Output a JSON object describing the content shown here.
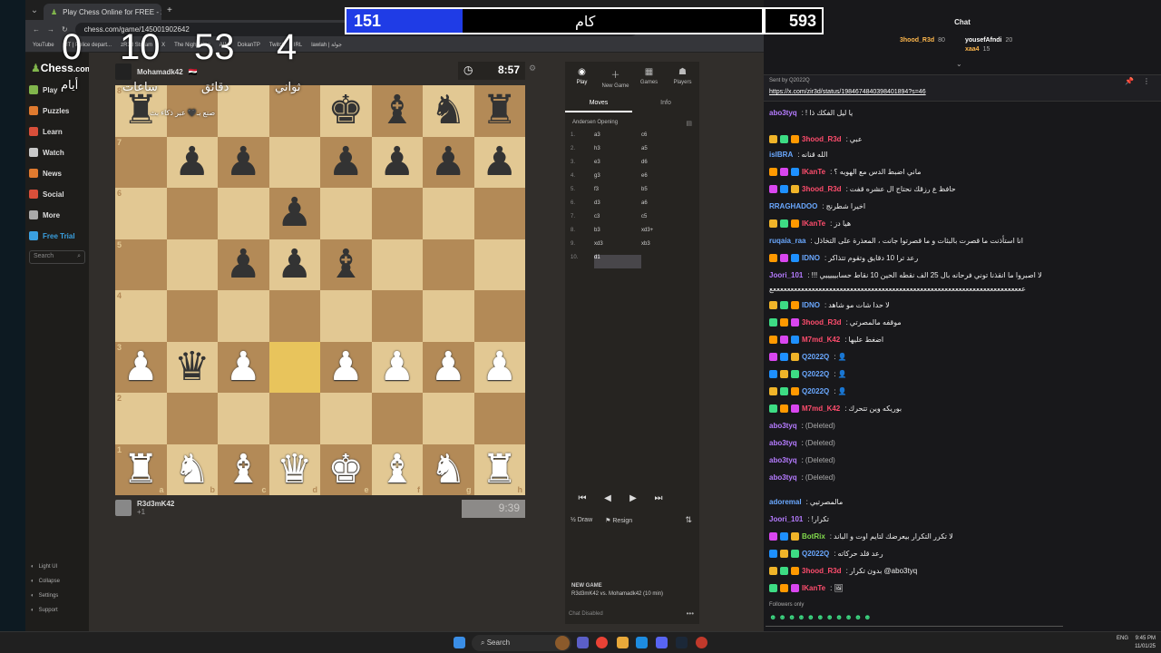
{
  "browser": {
    "tab_title": "Play Chess Online for FREE - 2 ...",
    "url": "chess.com/game/145001902642",
    "bookmarks": [
      "YouTube",
      "MT | Police depart...",
      "zR3d Stream",
      "X",
      "The Night King",
      "AIN",
      "DokanTP",
      "Twitch",
      "IRL",
      "lawlah | جولة"
    ]
  },
  "sidebar": {
    "logo_prefix": "Chess",
    "logo_suffix": ".com",
    "items": [
      {
        "label": "Play",
        "icon": "pawn-icon",
        "color": "#81b64c"
      },
      {
        "label": "Puzzles",
        "icon": "puzzle-icon",
        "color": "#e07a2f"
      },
      {
        "label": "Learn",
        "icon": "graduation-icon",
        "color": "#d94f3a"
      },
      {
        "label": "Watch",
        "icon": "tv-icon",
        "color": "#c9c9c9"
      },
      {
        "label": "News",
        "icon": "news-icon",
        "color": "#e07a2f"
      },
      {
        "label": "Social",
        "icon": "people-icon",
        "color": "#d94f3a"
      },
      {
        "label": "More",
        "icon": "more-icon",
        "color": "#aaa"
      },
      {
        "label": "Free Trial",
        "icon": "diamond-icon",
        "color": "#3aa0e0"
      }
    ],
    "search_placeholder": "Search",
    "bottom": [
      "Light UI",
      "Collapse",
      "Settings",
      "Support"
    ]
  },
  "overlay": {
    "numbers": [
      "0",
      "10",
      "53",
      "4"
    ],
    "labels": [
      "أيام",
      "ساعات",
      "دقائق",
      "ثواني"
    ],
    "caption": "صنع بـ🖤 عبر ذكاء بث",
    "bar_value": "151",
    "bar_word": "كام",
    "bar_fill_percent": 28,
    "counter": "593"
  },
  "game": {
    "top_player": "Mohamadk42",
    "top_player_sub": "🇮🇶",
    "top_clock": "8:57",
    "bottom_player": "R3d3mK42",
    "bottom_player_sub": "+1",
    "bottom_clock": "9:39",
    "ranks": [
      "8",
      "7",
      "6",
      "5",
      "4",
      "3",
      "2",
      "1"
    ],
    "files": [
      "a",
      "b",
      "c",
      "d",
      "e",
      "f",
      "g",
      "h"
    ],
    "board": [
      [
        "br",
        "",
        "",
        "",
        "bk",
        "bb",
        "bn",
        "br"
      ],
      [
        "",
        "bp",
        "bp",
        "",
        "bp",
        "bp",
        "bp",
        "bp"
      ],
      [
        "",
        "",
        "",
        "bp",
        "",
        "",
        "",
        ""
      ],
      [
        "",
        "",
        "bp",
        "bp",
        "bb",
        "",
        "",
        ""
      ],
      [
        "",
        "",
        "",
        "",
        "",
        "",
        "",
        ""
      ],
      [
        "wp",
        "bq",
        "wp",
        "",
        "wp",
        "wp",
        "wp",
        "wp"
      ],
      [
        "",
        "",
        "",
        "",
        "",
        "",
        "",
        ""
      ],
      [
        "wr",
        "wn",
        "wb",
        "wq",
        "wk",
        "wb",
        "wn",
        "wr"
      ]
    ],
    "highlight": [
      5,
      3
    ]
  },
  "panel": {
    "tabs": [
      {
        "label": "Play",
        "icon": "play-icon"
      },
      {
        "label": "New Game",
        "icon": "plus-icon"
      },
      {
        "label": "Games",
        "icon": "games-icon"
      },
      {
        "label": "Players",
        "icon": "players-icon"
      }
    ],
    "subtabs": [
      "Moves",
      "Info"
    ],
    "opening": "Andersen Opening",
    "moves": [
      {
        "n": "1.",
        "w": "a3",
        "b": "c6"
      },
      {
        "n": "2.",
        "w": "h3",
        "b": "a5"
      },
      {
        "n": "3.",
        "w": "e3",
        "b": "d6"
      },
      {
        "n": "4.",
        "w": "g3",
        "b": "e6"
      },
      {
        "n": "5.",
        "w": "f3",
        "b": "b5"
      },
      {
        "n": "6.",
        "w": "d3",
        "b": "a6"
      },
      {
        "n": "7.",
        "w": "c3",
        "b": "c5"
      },
      {
        "n": "8.",
        "w": "b3",
        "b": "xd3+"
      },
      {
        "n": "9.",
        "w": "xd3",
        "b": "xb3"
      },
      {
        "n": "10.",
        "w": "d1",
        "b": ""
      }
    ],
    "draw": "Draw",
    "resign": "Resign",
    "new_game_title": "NEW GAME",
    "new_game_desc": "R3d3mK42 vs. Mohamadk42 (10 min)",
    "chat_disabled": "Chat Disabled"
  },
  "chat": {
    "title": "Chat",
    "top_users": [
      {
        "name": "3hood_R3d",
        "count": "80"
      },
      {
        "name": "yousefAfndi",
        "count": "20"
      },
      {
        "name": "xaa4",
        "count": "15"
      }
    ],
    "pinned_sender": "Sent by Q2022Q",
    "pinned_link": "https://x.com/zir3d/status/1984674840398401894?s=46",
    "messages": [
      {
        "user": "abo3tyq",
        "color": "#b57bff",
        "text": "! يا ليل الفكك ذا"
      },
      {
        "user": "3hood_R3d",
        "color": "#ff4d6d",
        "text": "عبي"
      },
      {
        "user": "islBRA",
        "color": "#6aa8ff",
        "text": "الله قنانه"
      },
      {
        "user": "IKanTe",
        "color": "#ff4d6d",
        "text": "ماني اضبط الدس مع الهويه ؟"
      },
      {
        "user": "3hood_R3d",
        "color": "#ff4d6d",
        "text": "حافظ ع رزقك نحتاج ال عشره قفت"
      },
      {
        "user": "RRAGHADOO",
        "color": "#6aa8ff",
        "text": "اخيرا شطرنج"
      },
      {
        "user": "IKanTe",
        "color": "#ff4d6d",
        "text": "هيا دز"
      },
      {
        "user": "ruqaia_raa",
        "color": "#6aa8ff",
        "text": "انا استأذنت ما قصرت بالبثات و ما قصرتوا جانت ، المعذرة على التخاذل"
      },
      {
        "user": "IDNO",
        "color": "#6aa8ff",
        "text": "رعد ترا 10 دقايق وتقوم تتذاكر"
      },
      {
        "user": "Joori_101",
        "color": "#b57bff",
        "text": "!!! لا اصبروا ما انقذنا توني فرحانه بال 25 الف نقطه الحين 10 نقاط حسابيييييي"
      },
      {
        "user": "",
        "color": "#eee",
        "text": "ععععععععععععععععععععععععععععععععععععععععععععععععععععععععععععععععععععععععع"
      },
      {
        "user": "IDNO",
        "color": "#6aa8ff",
        "text": "لا حدا شات مو شاهد"
      },
      {
        "user": "3hood_R3d",
        "color": "#ff4d6d",
        "text": "موقفه مالمصرتي"
      },
      {
        "user": "M7md_K42",
        "color": "#ff4d6d",
        "text": "اضغط عليها"
      },
      {
        "user": "Q2022Q",
        "color": "#6aa8ff",
        "text": "👤"
      },
      {
        "user": "Q2022Q",
        "color": "#6aa8ff",
        "text": "👤"
      },
      {
        "user": "Q2022Q",
        "color": "#6aa8ff",
        "text": "👤"
      },
      {
        "user": "M7md_K42",
        "color": "#ff4d6d",
        "text": "بوريكه وين تتحرك"
      },
      {
        "user": "abo3tyq",
        "color": "#b57bff",
        "text": "(Deleted)"
      },
      {
        "user": "abo3tyq",
        "color": "#b57bff",
        "text": "(Deleted)"
      },
      {
        "user": "abo3tyq",
        "color": "#b57bff",
        "text": "(Deleted)"
      },
      {
        "user": "abo3tyq",
        "color": "#b57bff",
        "text": "(Deleted)"
      },
      {
        "user": "adoremal",
        "color": "#6aa8ff",
        "text": "مالمصرتيي"
      },
      {
        "user": "Joori_101",
        "color": "#b57bff",
        "text": "!تكرار"
      },
      {
        "user": "BotRix",
        "color": "#81d94c",
        "text": "لا تكرر التكرار بيعرضك لتايم اوت و الباند"
      },
      {
        "user": "Q2022Q",
        "color": "#6aa8ff",
        "text": "رعد قلد حركاته"
      },
      {
        "user": "3hood_R3d",
        "color": "#ff4d6d",
        "text": "بدون تكرار @abo3tyq"
      },
      {
        "user": "IKanTe",
        "color": "#ff4d6d",
        "text": "🖼"
      }
    ],
    "followers_only": "Followers only"
  },
  "taskbar": {
    "search": "Search",
    "lang": "ENG",
    "time": "9:45 PM",
    "date": "11/01/25"
  }
}
